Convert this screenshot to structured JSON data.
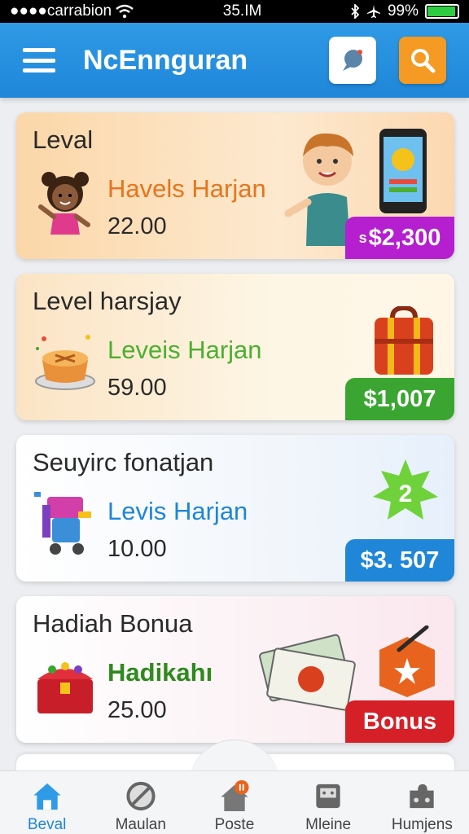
{
  "status_bar": {
    "carrier": "●●●●carrabion",
    "time": "35.IM",
    "battery": "99%"
  },
  "app_bar": {
    "title": "NcEnnguran"
  },
  "cards": [
    {
      "title": "Leval",
      "subtitle": "Havels Harjan",
      "subtitle_color": "#e8741c",
      "value": "22.00",
      "price": "$2,300",
      "price_prefix": "s",
      "badge_color": "#b51fcf"
    },
    {
      "title": "Level harsjay",
      "subtitle": "Leveis Harjan",
      "subtitle_color": "#4caf30",
      "value": "59.00",
      "price": "$1,007",
      "badge_color": "#3aa631"
    },
    {
      "title": "Seuyirc fonatjan",
      "subtitle": "Levis Harjan",
      "subtitle_color": "#1f86d8",
      "value": "10.00",
      "price": "$3. 507",
      "badge_color": "#1f86d8",
      "star_number": "2"
    },
    {
      "title": "Hadiah Bonua",
      "subtitle": "Hadikahı",
      "subtitle_color": "#2f8a1e",
      "value": "25.00",
      "price": "Bonus",
      "badge_color": "#d62027"
    }
  ],
  "peek_card": {
    "text": "· · ·"
  },
  "nav": [
    {
      "label": "Beval",
      "icon": "home-icon",
      "active": true
    },
    {
      "label": "Maulan",
      "icon": "no-symbol-icon",
      "active": false
    },
    {
      "label": "Poste",
      "icon": "post-house-icon",
      "active": false
    },
    {
      "label": "Mleine",
      "icon": "mailbox-icon",
      "active": false
    },
    {
      "label": "Humjens",
      "icon": "puzzle-icon",
      "active": false
    }
  ],
  "colors": {
    "primary": "#1f86d8",
    "accent": "#f59a23"
  }
}
